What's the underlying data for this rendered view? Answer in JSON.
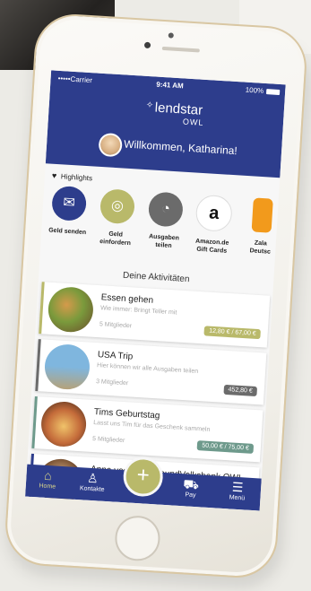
{
  "status": {
    "carrier": "•••••Carrier",
    "time": "9:41 AM",
    "battery": "100%"
  },
  "brand": {
    "name": "lendstar",
    "sub": "OWL"
  },
  "welcome": "Willkommen, Katharina!",
  "highlights": {
    "title": "Highlights",
    "items": [
      {
        "label": "Geld  senden",
        "color": "#2d3d8c"
      },
      {
        "label": "Geld\neinfordern",
        "color": "#b9b96a"
      },
      {
        "label": "Ausgaben\nteilen",
        "color": "#6b6b6b"
      },
      {
        "label": "Amazon.de\nGift Cards",
        "color": "#ffffff"
      },
      {
        "label": "Zala\nDeutsc",
        "color": "#f29a1c"
      }
    ]
  },
  "activities": {
    "title": "Deine Aktivitäten",
    "items": [
      {
        "title": "Essen gehen",
        "desc": "Wie immer: Bringt Teller mit",
        "members": "5 Mitglieder",
        "amount": "12,80 € / 67,00 €",
        "color": "#b9b96a"
      },
      {
        "title": "USA Trip",
        "desc": "Hier können wir alle Ausgaben teilen",
        "members": "3 Mitglieder",
        "amount": "452,80 €",
        "color": "#6b6b6b"
      },
      {
        "title": "Tims Geburtstag",
        "desc": "Lasst uns Tim für das Geschenk sammeln",
        "members": "5 Mitglieder",
        "amount": "50,00 € / 75,00 €",
        "color": "#6e9a8c"
      },
      {
        "title": "Anna von der VerbundVolksbank OWL",
        "desc": "",
        "members": "",
        "amount": "",
        "color": "#2d3d8c"
      }
    ]
  },
  "nav": {
    "home": "Home",
    "contacts": "Kontakte",
    "pay": "Pay",
    "menu": "Menü"
  },
  "plus_symbol": "+",
  "colors": {
    "brand": "#2d3d8c",
    "accent": "#b9b96a"
  }
}
